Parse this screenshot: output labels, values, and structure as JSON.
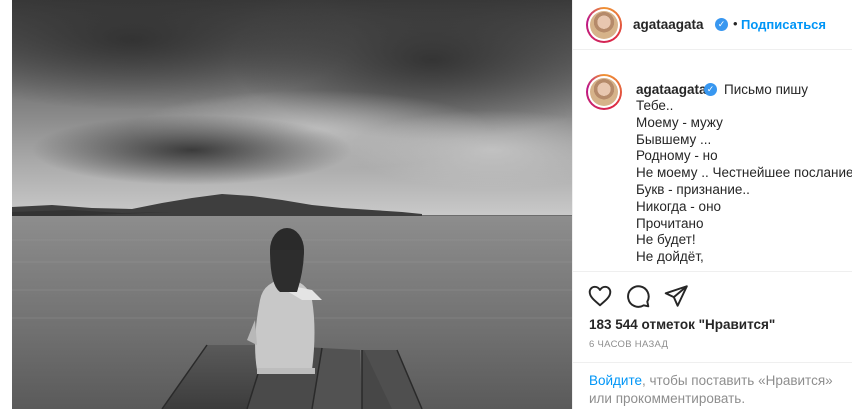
{
  "post": {
    "username": "agataagata",
    "header": {
      "follow_label": "Подписаться",
      "separator": "•"
    },
    "caption": {
      "first_line": "Письмо пишу",
      "lines": [
        "Тебе..",
        "Моему - мужу",
        "Бывшему ...",
        "Родному - но",
        "Не моему .. Честнейшее послание",
        "Букв - признание..",
        "Никогда - оно",
        "Прочитано",
        "Не будет!",
        "Не дойдёт,"
      ]
    },
    "actions": {
      "like_icon": "heart-icon",
      "comment_icon": "comment-icon",
      "share_icon": "paper-plane-icon"
    },
    "likes_text": "183 544 отметок \"Нравится\"",
    "time_text": "6 ЧАСОВ НАЗАД",
    "login_prompt": {
      "link": "Войдите",
      "text": ", чтобы поставить «Нравится» или прокомментировать."
    }
  },
  "colors": {
    "link_blue": "#0095f6",
    "verified_blue": "#3897f0",
    "muted_text": "#8e8e8e",
    "border": "#efefef"
  }
}
